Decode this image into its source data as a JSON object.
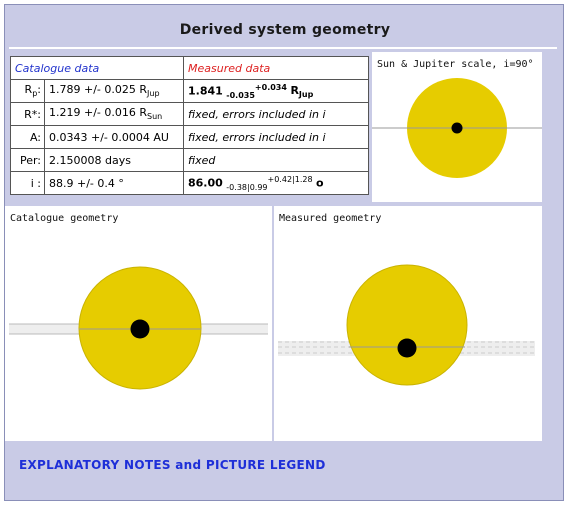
{
  "title": "Derived system geometry",
  "table": {
    "header_catalogue": "Catalogue data",
    "header_measured": "Measured data",
    "rows": [
      {
        "label": "Rp:",
        "label_sub": "p",
        "catalogue": "1.789 +/- 0.025 R",
        "catalogue_sub": "Jup",
        "measured": "1.841",
        "measured_extra": "-0.035",
        "measured_sup": "+0.034",
        "measured_unit": "RJup"
      },
      {
        "label": "R*:",
        "catalogue": "1.219 +/- 0.016 R",
        "catalogue_sub": "Sun",
        "measured": "fixed, errors included in i"
      },
      {
        "label": "A:",
        "catalogue": "0.0343 +/- 0.0004 AU",
        "measured": "fixed, errors included in i"
      },
      {
        "label": "Per:",
        "catalogue": "2.150008 days",
        "measured": "fixed"
      },
      {
        "label": "i :",
        "catalogue": "88.9 +/- 0.4 °",
        "measured": "86.00",
        "measured_extra": "-0.38|0.99",
        "measured_sup": "+0.42|1.28",
        "measured_unit": "o"
      }
    ]
  },
  "scale_panel": {
    "label": "Sun & Jupiter scale, i=90°"
  },
  "catalogue_panel": {
    "label": "Catalogue geometry"
  },
  "measured_panel": {
    "label": "Measured geometry"
  },
  "notes_link": "EXPLANATORY NOTES and PICTURE LEGEND",
  "colors": {
    "star": "#e6cc00",
    "planet": "#000000",
    "orbit": "#999999",
    "band": "#cccccc"
  }
}
